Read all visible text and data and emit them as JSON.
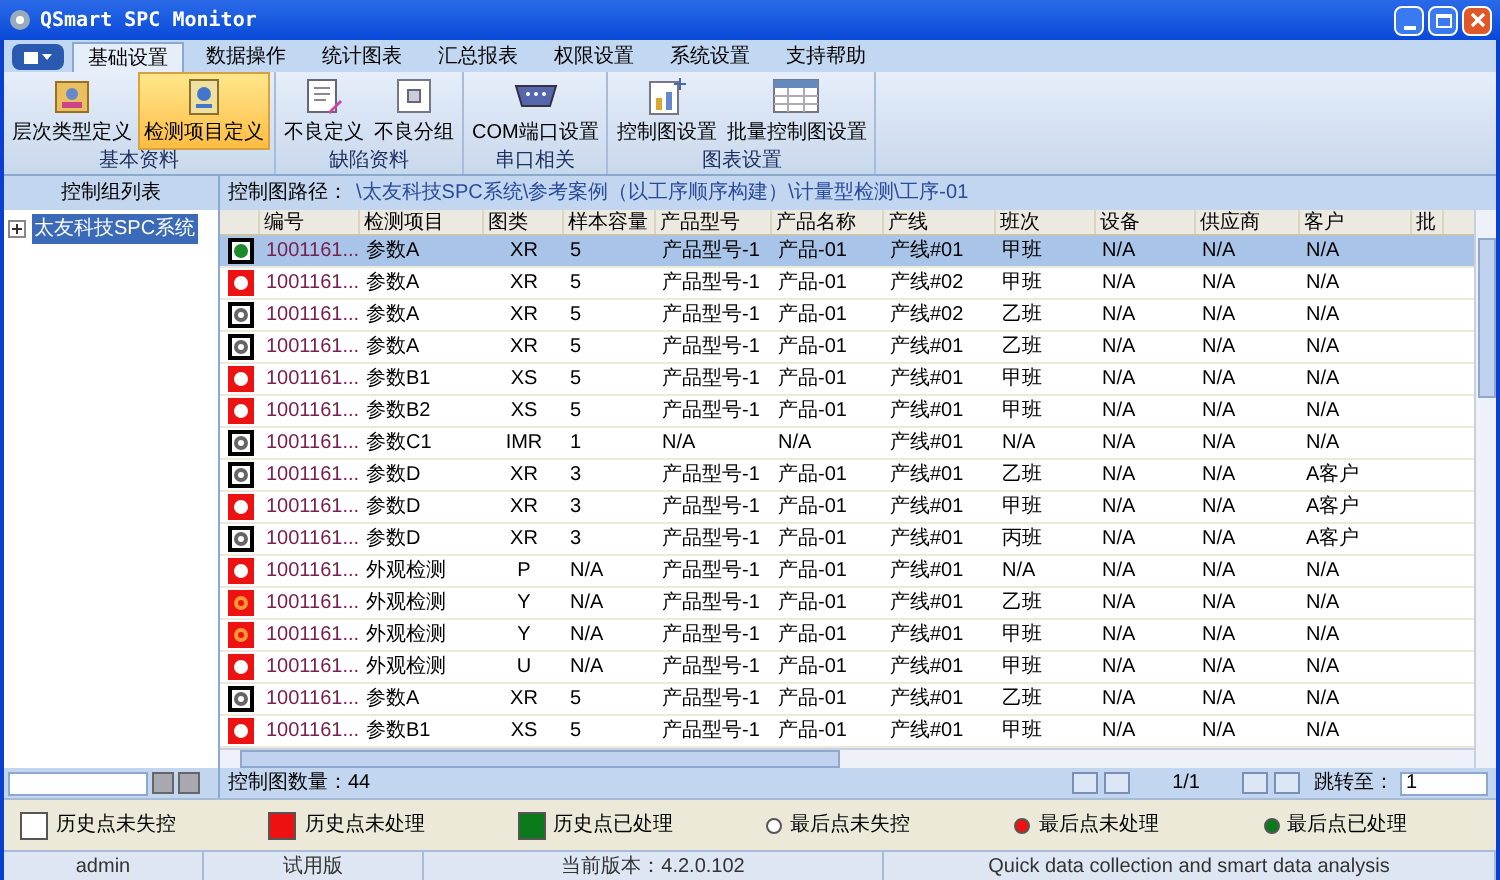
{
  "window": {
    "title": "QSmart SPC Monitor"
  },
  "menu_tabs": [
    {
      "label": "基础设置",
      "selected": true
    },
    {
      "label": "数据操作",
      "selected": false
    },
    {
      "label": "统计图表",
      "selected": false
    },
    {
      "label": "汇总报表",
      "selected": false
    },
    {
      "label": "权限设置",
      "selected": false
    },
    {
      "label": "系统设置",
      "selected": false
    },
    {
      "label": "支持帮助",
      "selected": false
    }
  ],
  "ribbon_groups": [
    {
      "title": "基本资料",
      "buttons": [
        {
          "label": "层次类型定义",
          "selected": false,
          "kind": "hierarchy"
        },
        {
          "label": "检测项目定义",
          "selected": true,
          "kind": "inspect"
        }
      ]
    },
    {
      "title": "缺陷资料",
      "buttons": [
        {
          "label": "不良定义",
          "selected": false,
          "kind": "defect"
        },
        {
          "label": "不良分组",
          "selected": false,
          "kind": "group"
        }
      ]
    },
    {
      "title": "串口相关",
      "buttons": [
        {
          "label": "COM端口设置",
          "selected": false,
          "kind": "port"
        }
      ]
    },
    {
      "title": "图表设置",
      "buttons": [
        {
          "label": "控制图设置",
          "selected": false,
          "kind": "chart"
        },
        {
          "label": "批量控制图设置",
          "selected": false,
          "kind": "batch"
        }
      ]
    }
  ],
  "left_panel": {
    "title": "控制组列表",
    "tree": [
      {
        "label": "太友科技SPC系统",
        "expanded": false
      }
    ]
  },
  "path": {
    "label": "控制图路径：",
    "value": "\\太友科技SPC系统\\参考案例（以工序顺序构建）\\计量型检测\\工序-01"
  },
  "table": {
    "columns": [
      "编号",
      "检测项目",
      "图类",
      "样本容量",
      "产品型号",
      "产品名称",
      "产线",
      "班次",
      "设备",
      "供应商",
      "客户",
      "批"
    ],
    "rows": [
      {
        "selected": true,
        "kind": "outline",
        "dot": {
          "kind": "filled",
          "color": "#1a8a2a"
        },
        "cells": [
          "1001161...",
          "参数A",
          "XR",
          "5",
          "产品型号-1",
          "产品-01",
          "产线#01",
          "甲班",
          "N/A",
          "N/A",
          "N/A"
        ]
      },
      {
        "selected": false,
        "kind": "alarm",
        "dot": {
          "kind": "filled",
          "color": "#ffffff"
        },
        "cells": [
          "1001161...",
          "参数A",
          "XR",
          "5",
          "产品型号-1",
          "产品-01",
          "产线#02",
          "甲班",
          "N/A",
          "N/A",
          "N/A"
        ]
      },
      {
        "selected": false,
        "kind": "outline",
        "dot": {
          "kind": "ring",
          "color": "#666666"
        },
        "cells": [
          "1001161...",
          "参数A",
          "XR",
          "5",
          "产品型号-1",
          "产品-01",
          "产线#02",
          "乙班",
          "N/A",
          "N/A",
          "N/A"
        ]
      },
      {
        "selected": false,
        "kind": "outline",
        "dot": {
          "kind": "ring",
          "color": "#666666"
        },
        "cells": [
          "1001161...",
          "参数A",
          "XR",
          "5",
          "产品型号-1",
          "产品-01",
          "产线#01",
          "乙班",
          "N/A",
          "N/A",
          "N/A"
        ]
      },
      {
        "selected": false,
        "kind": "alarm",
        "dot": {
          "kind": "filled",
          "color": "#ffffff"
        },
        "cells": [
          "1001161...",
          "参数B1",
          "XS",
          "5",
          "产品型号-1",
          "产品-01",
          "产线#01",
          "甲班",
          "N/A",
          "N/A",
          "N/A"
        ]
      },
      {
        "selected": false,
        "kind": "alarm",
        "dot": {
          "kind": "filled",
          "color": "#ffffff"
        },
        "cells": [
          "1001161...",
          "参数B2",
          "XS",
          "5",
          "产品型号-1",
          "产品-01",
          "产线#01",
          "甲班",
          "N/A",
          "N/A",
          "N/A"
        ]
      },
      {
        "selected": false,
        "kind": "outline",
        "dot": {
          "kind": "ring",
          "color": "#666666"
        },
        "cells": [
          "1001161...",
          "参数C1",
          "IMR",
          "1",
          "N/A",
          "N/A",
          "产线#01",
          "N/A",
          "N/A",
          "N/A",
          "N/A"
        ]
      },
      {
        "selected": false,
        "kind": "outline",
        "dot": {
          "kind": "ring",
          "color": "#666666"
        },
        "cells": [
          "1001161...",
          "参数D",
          "XR",
          "3",
          "产品型号-1",
          "产品-01",
          "产线#01",
          "乙班",
          "N/A",
          "N/A",
          "A客户"
        ]
      },
      {
        "selected": false,
        "kind": "alarm",
        "dot": {
          "kind": "filled",
          "color": "#ffffff"
        },
        "cells": [
          "1001161...",
          "参数D",
          "XR",
          "3",
          "产品型号-1",
          "产品-01",
          "产线#01",
          "甲班",
          "N/A",
          "N/A",
          "A客户"
        ]
      },
      {
        "selected": false,
        "kind": "outline",
        "dot": {
          "kind": "ring",
          "color": "#666666"
        },
        "cells": [
          "1001161...",
          "参数D",
          "XR",
          "3",
          "产品型号-1",
          "产品-01",
          "产线#01",
          "丙班",
          "N/A",
          "N/A",
          "A客户"
        ]
      },
      {
        "selected": false,
        "kind": "alarm",
        "dot": {
          "kind": "filled",
          "color": "#ffffff"
        },
        "cells": [
          "1001161...",
          "外观检测",
          "P",
          "N/A",
          "产品型号-1",
          "产品-01",
          "产线#01",
          "N/A",
          "N/A",
          "N/A",
          "N/A"
        ]
      },
      {
        "selected": false,
        "kind": "alarm",
        "dot": {
          "kind": "ring",
          "color": "#ff9933"
        },
        "cells": [
          "1001161...",
          "外观检测",
          "Y",
          "N/A",
          "产品型号-1",
          "产品-01",
          "产线#01",
          "乙班",
          "N/A",
          "N/A",
          "N/A"
        ]
      },
      {
        "selected": false,
        "kind": "alarm",
        "dot": {
          "kind": "ring",
          "color": "#ff9933"
        },
        "cells": [
          "1001161...",
          "外观检测",
          "Y",
          "N/A",
          "产品型号-1",
          "产品-01",
          "产线#01",
          "甲班",
          "N/A",
          "N/A",
          "N/A"
        ]
      },
      {
        "selected": false,
        "kind": "alarm",
        "dot": {
          "kind": "filled",
          "color": "#ffffff"
        },
        "cells": [
          "1001161...",
          "外观检测",
          "U",
          "N/A",
          "产品型号-1",
          "产品-01",
          "产线#01",
          "甲班",
          "N/A",
          "N/A",
          "N/A"
        ]
      },
      {
        "selected": false,
        "kind": "outline",
        "dot": {
          "kind": "ring",
          "color": "#666666"
        },
        "cells": [
          "1001161...",
          "参数A",
          "XR",
          "5",
          "产品型号-1",
          "产品-01",
          "产线#01",
          "乙班",
          "N/A",
          "N/A",
          "N/A"
        ]
      },
      {
        "selected": false,
        "kind": "alarm",
        "dot": {
          "kind": "filled",
          "color": "#ffffff"
        },
        "cells": [
          "1001161...",
          "参数B1",
          "XS",
          "5",
          "产品型号-1",
          "产品-01",
          "产线#01",
          "甲班",
          "N/A",
          "N/A",
          "N/A"
        ]
      }
    ]
  },
  "footer": {
    "count": "控制图数量：44",
    "page": "1/1",
    "jump_label": "跳转至：",
    "jump_value": "1"
  },
  "legend": [
    {
      "kind": "box",
      "label": "历史点未失控",
      "color": "#ffffff"
    },
    {
      "kind": "box",
      "label": "历史点未处理",
      "color": "#ee1111"
    },
    {
      "kind": "box",
      "label": "历史点已处理",
      "color": "#0a7a1a"
    },
    {
      "kind": "dot",
      "label": "最后点未失控",
      "color": "#ffffff"
    },
    {
      "kind": "dot",
      "label": "最后点未处理",
      "color": "#ee1111"
    },
    {
      "kind": "dot",
      "label": "最后点已处理",
      "color": "#0a7a1a"
    }
  ],
  "status_bar": [
    "admin",
    "试用版",
    "当前版本：4.2.0.102",
    "Quick data collection and smart data analysis"
  ]
}
